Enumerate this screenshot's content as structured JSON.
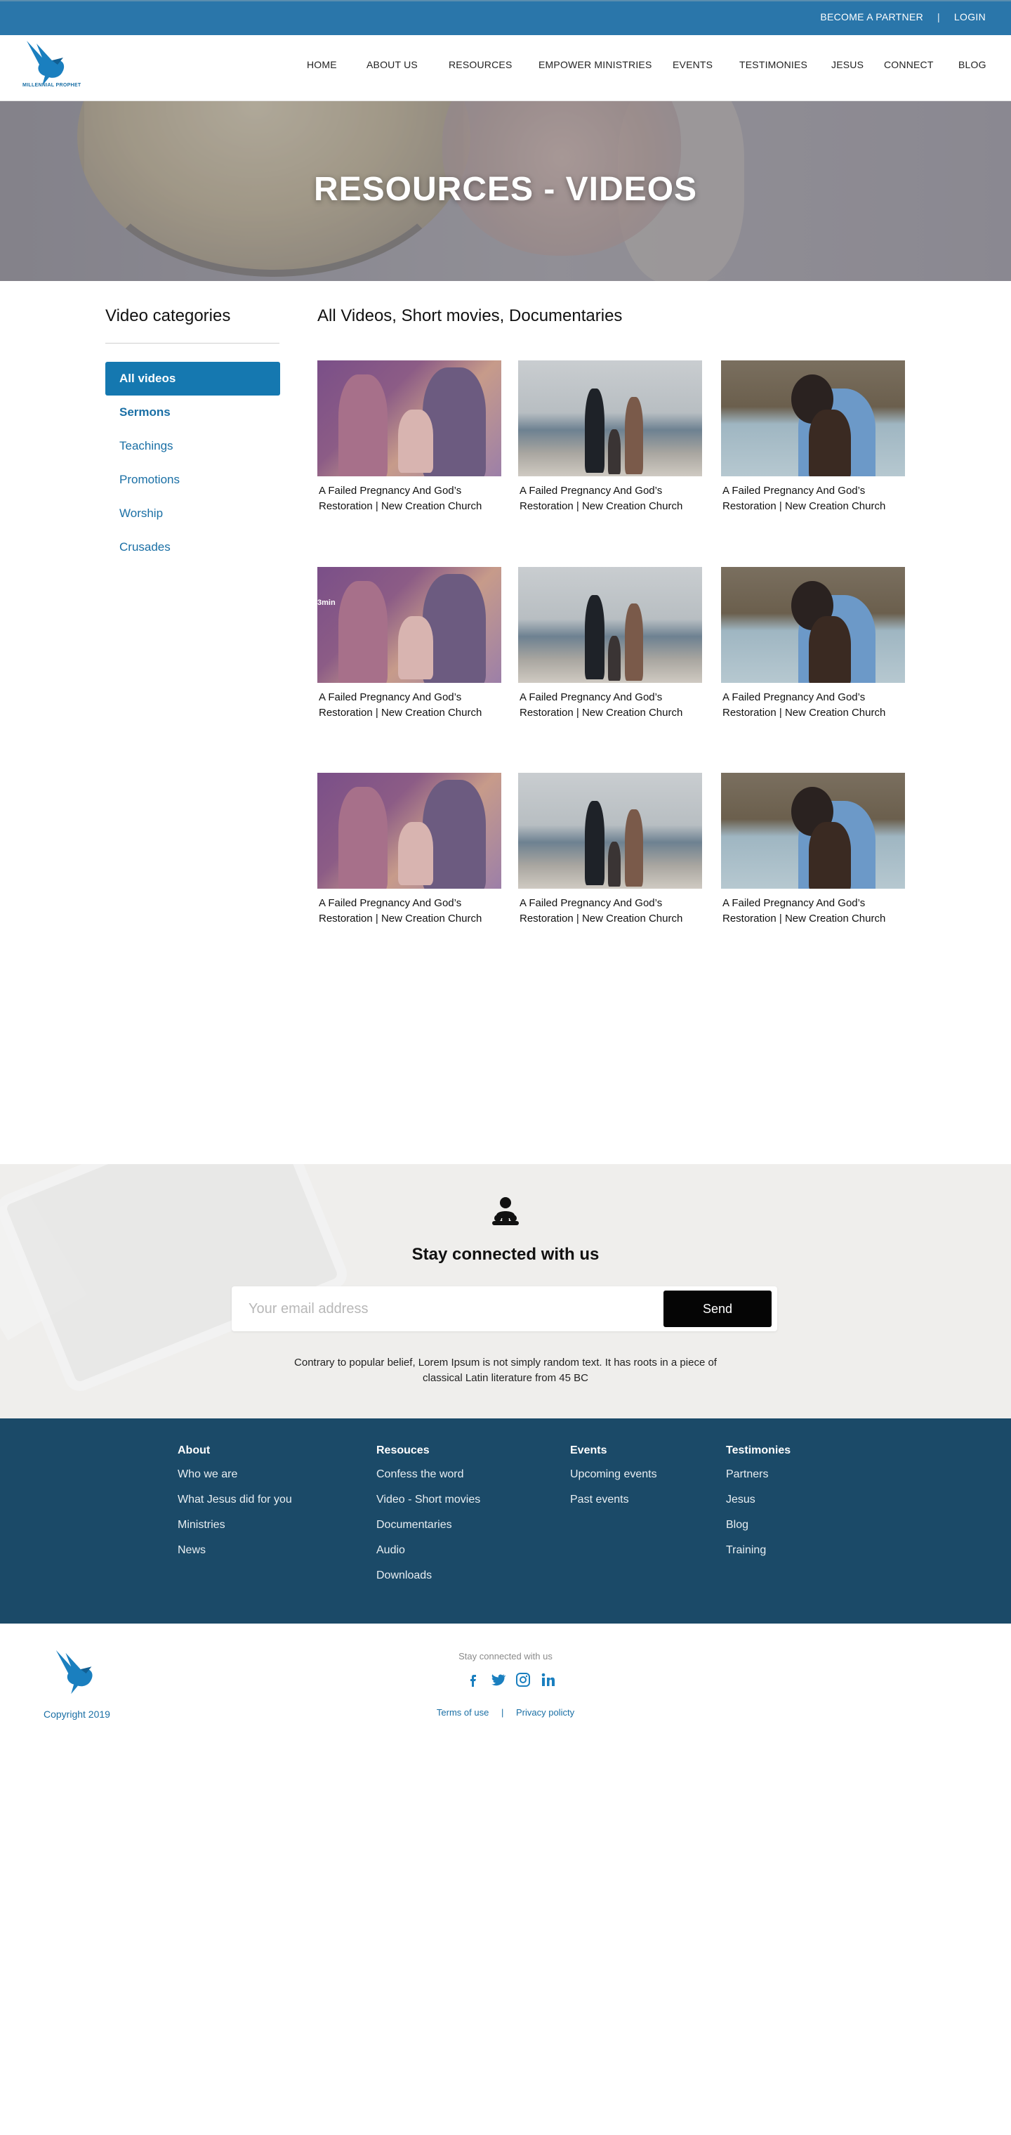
{
  "topbar": {
    "partner": "BECOME A PARTNER",
    "separator": "|",
    "login": "LOGIN"
  },
  "logo": {
    "text": "MILLENNIAL PROPHET",
    "icon": "dove-icon"
  },
  "nav": {
    "items": [
      "HOME",
      "ABOUT US",
      "RESOURCES",
      "EMPOWER MINISTRIES",
      "EVENTS",
      "TESTIMONIES",
      "JESUS",
      "CONNECT",
      "BLOG"
    ]
  },
  "hero": {
    "title": "RESOURCES - VIDEOS"
  },
  "sidebar": {
    "title": "Video categories",
    "items": [
      "All videos",
      "Sermons",
      "Teachings",
      "Promotions",
      "Worship",
      "Crusades"
    ]
  },
  "main": {
    "title": "All Videos, Short movies, Documentaries",
    "videos": [
      {
        "caption": "A Failed Pregnancy And God’s Restoration | New Creation Church",
        "tag": ""
      },
      {
        "caption": "A Failed Pregnancy And God’s Restoration | New Creation Church",
        "tag": ""
      },
      {
        "caption": "A Failed Pregnancy And God’s Restoration | New Creation Church",
        "tag": ""
      },
      {
        "caption": "A Failed Pregnancy And God’s Restoration | New Creation Church",
        "tag": "3min"
      },
      {
        "caption": "A Failed Pregnancy And God’s Restoration | New Creation Church",
        "tag": ""
      },
      {
        "caption": "A Failed Pregnancy And God’s Restoration | New Creation Church",
        "tag": ""
      },
      {
        "caption": "A Failed Pregnancy And God’s Restoration | New Creation Church",
        "tag": ""
      },
      {
        "caption": "A Failed Pregnancy And God’s Restoration | New Creation Church",
        "tag": ""
      },
      {
        "caption": "A Failed Pregnancy And God’s Restoration | New Creation Church",
        "tag": ""
      }
    ]
  },
  "newsletter": {
    "icon": "community-icon",
    "title": "Stay connected with us",
    "placeholder": "Your email address",
    "button": "Send",
    "description": "Contrary to popular belief, Lorem Ipsum is not simply random text. It has roots in a piece of classical Latin literature from 45 BC"
  },
  "footer": {
    "columns": [
      {
        "head": "About",
        "links": [
          "Who we are",
          "What Jesus did for you",
          "Ministries",
          "News"
        ]
      },
      {
        "head": "Resouces",
        "links": [
          "Confess the word",
          "Video - Short movies",
          "Documentaries",
          "Audio",
          "Downloads"
        ]
      },
      {
        "head": "Events",
        "links": [
          "Upcoming events",
          "Past events"
        ]
      },
      {
        "head": "Testimonies",
        "links": [
          "Partners",
          "Jesus",
          "Blog",
          "Training"
        ]
      }
    ]
  },
  "bottom": {
    "copyright": "Copyright 2019",
    "stay": "Stay connected with us",
    "socials": [
      "facebook-icon",
      "twitter-icon",
      "instagram-icon",
      "linkedin-icon"
    ],
    "terms": "Terms of use",
    "separator": "|",
    "privacy": "Privacy policty"
  },
  "colors": {
    "accent": "#1578b0",
    "topbar": "#2a76aa",
    "footer": "#1b4a68",
    "link": "#1a6fa5"
  }
}
